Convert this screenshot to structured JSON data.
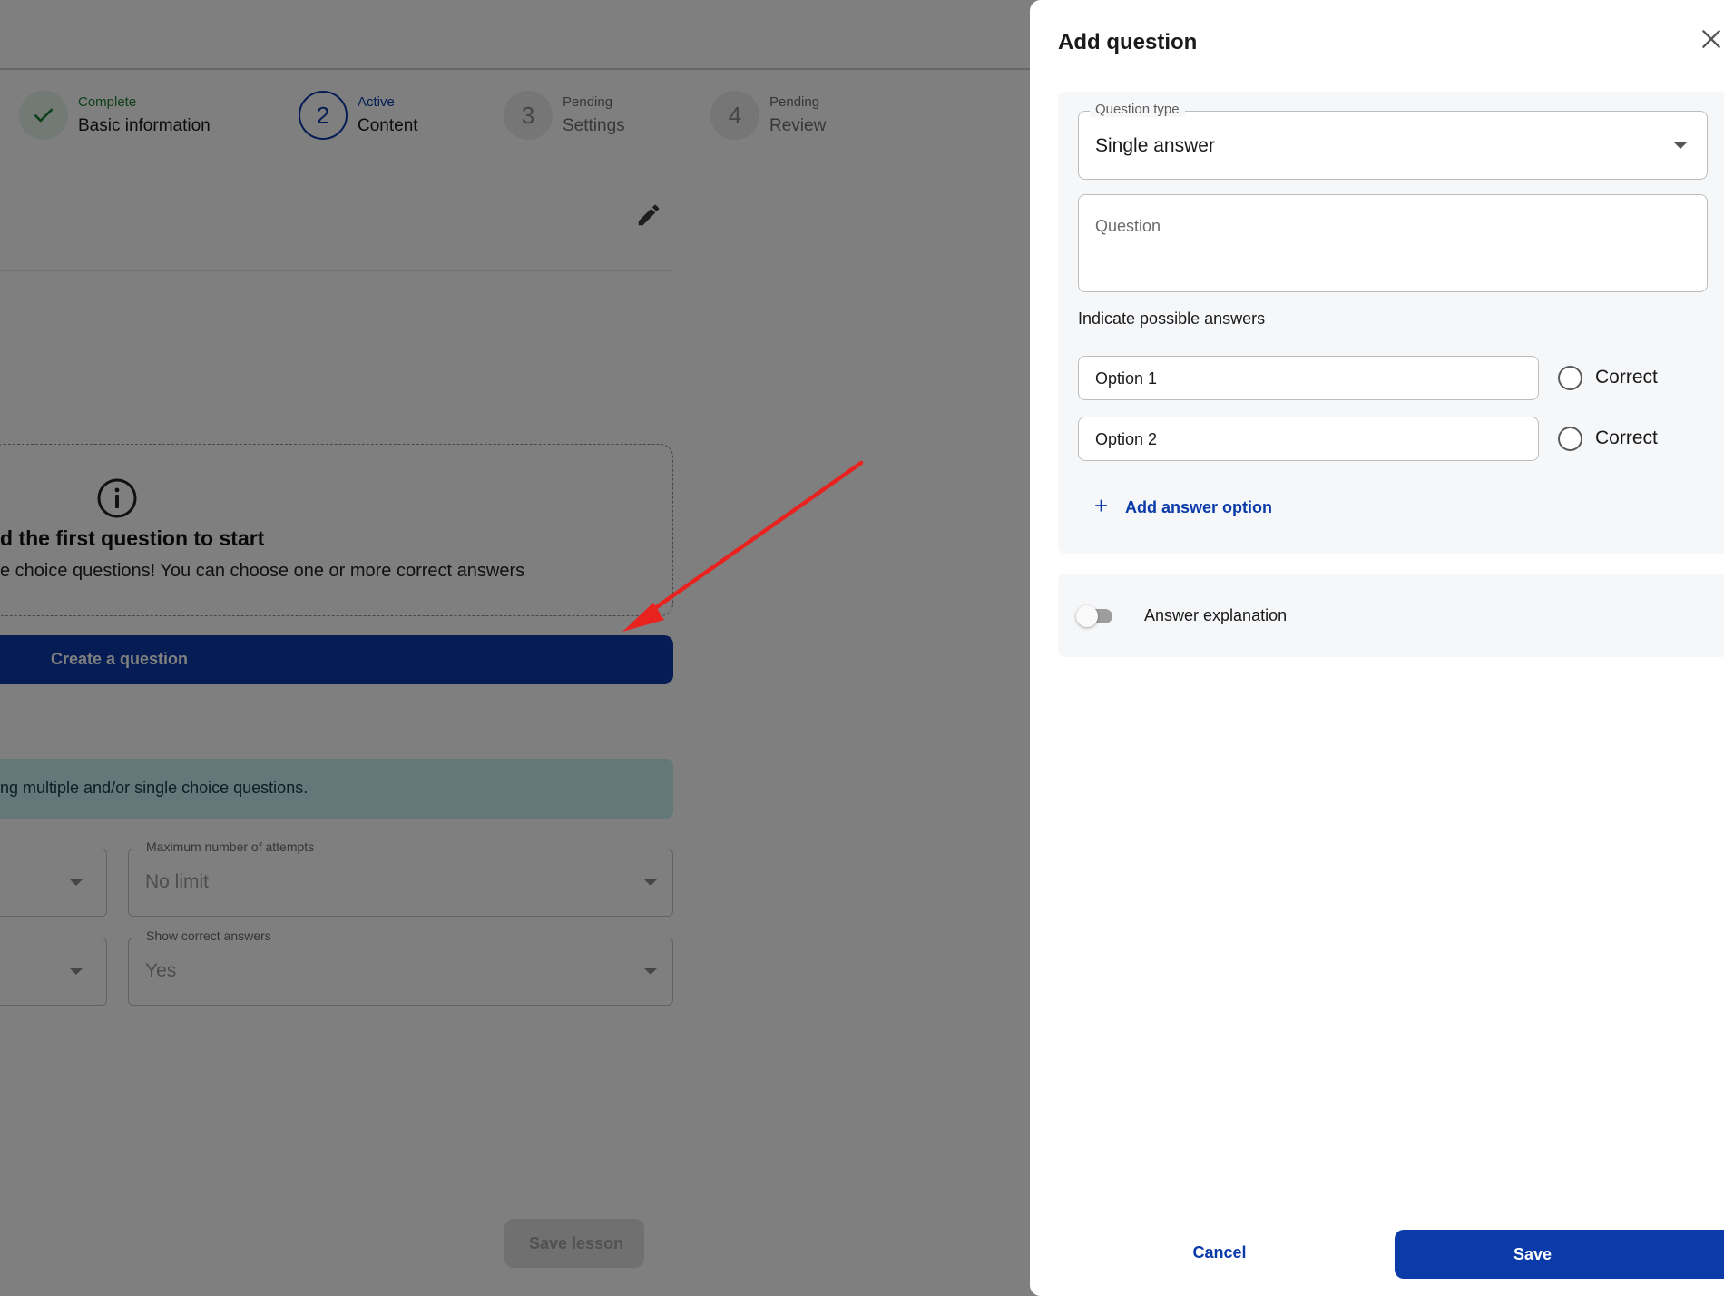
{
  "stepper": {
    "steps": [
      {
        "status": "Complete",
        "title": "Basic information",
        "number": "",
        "state": "done"
      },
      {
        "status": "Active",
        "title": "Content",
        "number": "2",
        "state": "active"
      },
      {
        "status": "Pending",
        "title": "Settings",
        "number": "3",
        "state": "pending"
      },
      {
        "status": "Pending",
        "title": "Review",
        "number": "4",
        "state": "pending"
      }
    ]
  },
  "empty_state": {
    "title": "d the first question to start",
    "subtitle": "e choice questions! You can choose one or more correct answers",
    "icon": "info-icon"
  },
  "create_question_label": "Create a question",
  "info_banner": "ng multiple and/or single choice questions.",
  "settings": {
    "max_attempts": {
      "label": "Maximum number of attempts",
      "value": "No limit"
    },
    "show_correct": {
      "label": "Show correct answers",
      "value": "Yes"
    }
  },
  "save_lesson_label": "Save lesson",
  "annotation": {
    "arrow_color": "#e8231f"
  },
  "drawer": {
    "title": "Add question",
    "question_type": {
      "label": "Question type",
      "value": "Single answer"
    },
    "question_placeholder": "Question",
    "answers_label": "Indicate possible answers",
    "options": [
      {
        "value": "Option 1",
        "correct_label": "Correct",
        "correct": false
      },
      {
        "value": "Option 2",
        "correct_label": "Correct",
        "correct": false
      }
    ],
    "add_option_label": "Add answer option",
    "explanation_label": "Answer explanation",
    "explanation_enabled": false,
    "cancel_label": "Cancel",
    "save_label": "Save"
  },
  "colors": {
    "primary": "#0a3ba8",
    "success": "#1e7d34",
    "info_banner_bg": "#c8f1f2",
    "overlay": "rgba(0,0,0,0.5)"
  }
}
